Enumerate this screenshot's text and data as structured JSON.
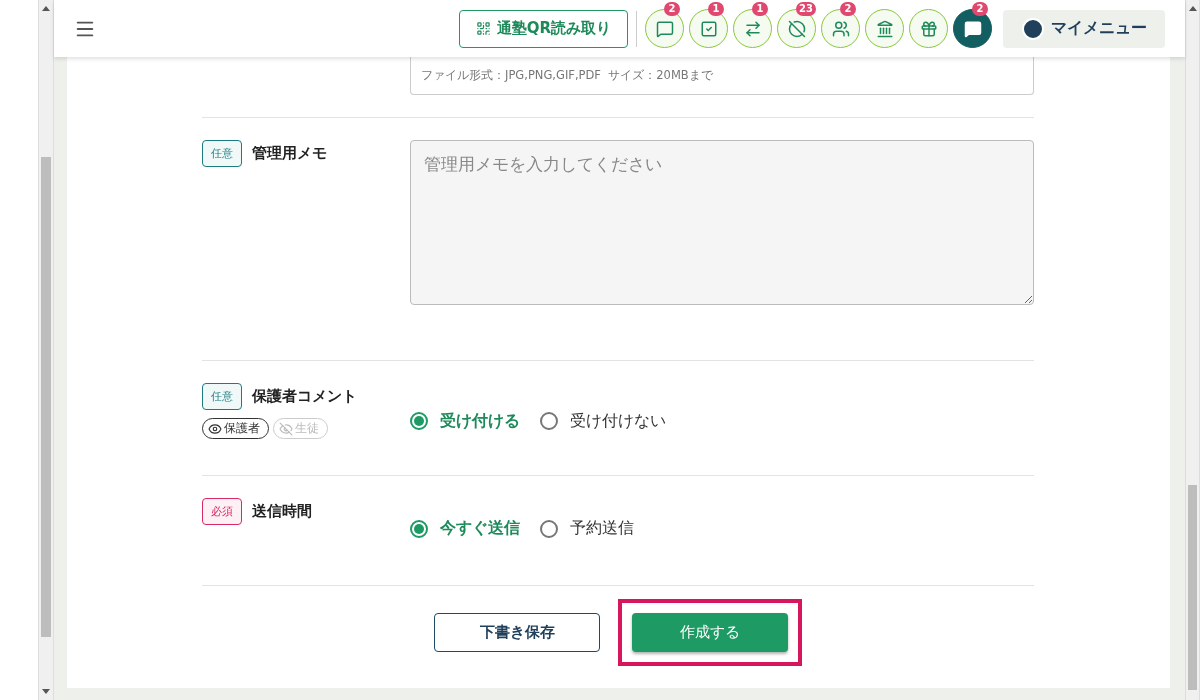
{
  "header": {
    "qr_button": "通塾QR読み取り",
    "icon_buttons": [
      {
        "kind": "outline",
        "badge": "2"
      },
      {
        "kind": "outline",
        "badge": "1"
      },
      {
        "kind": "outline",
        "badge": "1"
      },
      {
        "kind": "outline",
        "badge": "23"
      },
      {
        "kind": "outline",
        "badge": "2"
      },
      {
        "kind": "outline"
      },
      {
        "kind": "outline"
      },
      {
        "kind": "filled",
        "badge": "2"
      }
    ],
    "my_menu": "マイメニュー"
  },
  "file_field": {
    "hint": "ファイル形式：JPG,PNG,GIF,PDF  サイズ：20MBまで"
  },
  "memo": {
    "tag": "任意",
    "required": false,
    "label": "管理用メモ",
    "placeholder": "管理用メモを入力してください"
  },
  "guardian_comment": {
    "tag": "任意",
    "required": false,
    "label": "保護者コメント",
    "visibility": [
      {
        "label": "保護者",
        "visible": true
      },
      {
        "label": "生徒",
        "visible": false
      }
    ],
    "options": [
      {
        "label": "受け付ける",
        "selected": true
      },
      {
        "label": "受け付けない",
        "selected": false
      }
    ]
  },
  "send_time": {
    "tag": "必須",
    "required": true,
    "label": "送信時間",
    "options": [
      {
        "label": "今すぐ送信",
        "selected": true
      },
      {
        "label": "予約送信",
        "selected": false
      }
    ]
  },
  "buttons": {
    "draft": "下書き保存",
    "create": "作成する",
    "create_highlighted": true
  }
}
